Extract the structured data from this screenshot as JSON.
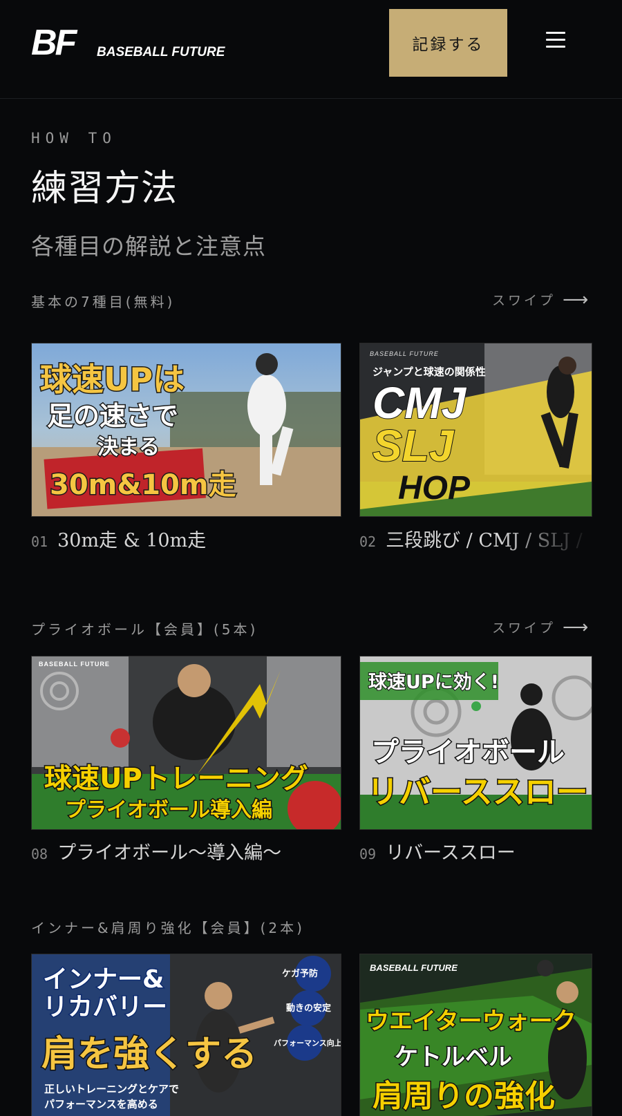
{
  "header": {
    "logo_mark": "BF",
    "logo_text": "BASEBALL FUTURE",
    "record_button": "記録する"
  },
  "hero": {
    "eyebrow": "HOW TO",
    "title": "練習方法",
    "subtitle": "各種目の解説と注意点"
  },
  "sections": [
    {
      "title": "基本の7種目(無料)",
      "swipe_label": "スワイプ",
      "cards": [
        {
          "number": "01",
          "title": "30m走 & 10m走",
          "thumb_lines": [
            "球速UPは",
            "足の速さで",
            "決まる",
            "30m&10m走"
          ]
        },
        {
          "number": "02",
          "title": "三段跳び / CMJ / SLJ /",
          "thumb_brand": "BASEBALL FUTURE",
          "thumb_lines": [
            "ジャンプと球速の関係性",
            "CMJ",
            "SLJ",
            "HOP"
          ]
        }
      ]
    },
    {
      "title": "プライオボール【会員】(5本)",
      "swipe_label": "スワイプ",
      "cards": [
        {
          "number": "08",
          "title": "プライオボール〜導入編〜",
          "thumb_brand": "BASEBALL FUTURE",
          "thumb_lines": [
            "球速UPトレーニング",
            "プライオボール導入編"
          ]
        },
        {
          "number": "09",
          "title": "リバーススロー",
          "thumb_lines": [
            "球速UPに効く!",
            "プライオボール",
            "リバーススロー"
          ]
        }
      ]
    },
    {
      "title": "インナー&肩周り強化【会員】(2本)",
      "cards": [
        {
          "thumb_lines": [
            "インナー&",
            "リカバリー",
            "肩を強くする",
            "正しいトレーニングとケアで",
            "パフォーマンスを高める"
          ],
          "thumb_badges": [
            "ケガ予防",
            "動きの安定",
            "パフォーマンス向上"
          ]
        },
        {
          "thumb_brand": "BASEBALL FUTURE",
          "thumb_lines": [
            "ウエイターウォーク",
            "ケトルベル",
            "肩周りの強化"
          ]
        }
      ]
    }
  ],
  "colors": {
    "background": "#08090b",
    "accent_gold": "#c6ad76",
    "thumb_yellow": "#f5d000",
    "thumb_green": "#4cd137"
  }
}
